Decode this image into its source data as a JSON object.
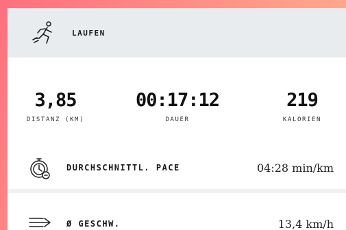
{
  "activity": {
    "title": "LAUFEN",
    "icon": "runner-icon"
  },
  "stats": [
    {
      "value": "3,85",
      "label": "DISTANZ (KM)"
    },
    {
      "value": "00:17:12",
      "label": "DAUER"
    },
    {
      "value": "219",
      "label": "KALORIEN"
    }
  ],
  "metrics": [
    {
      "label": "DURCHSCHNITTL. PACE",
      "value": "04:28 min/km",
      "icon": "stopwatch-icon"
    },
    {
      "label": "Ø GESCHW.",
      "value": "13,4 km/h",
      "icon": "speed-arrows-icon"
    }
  ],
  "colors": {
    "background_gradient_start": "#ff6f7d",
    "background_gradient_end": "#ffc39b",
    "header_bg": "#e9ecee"
  }
}
